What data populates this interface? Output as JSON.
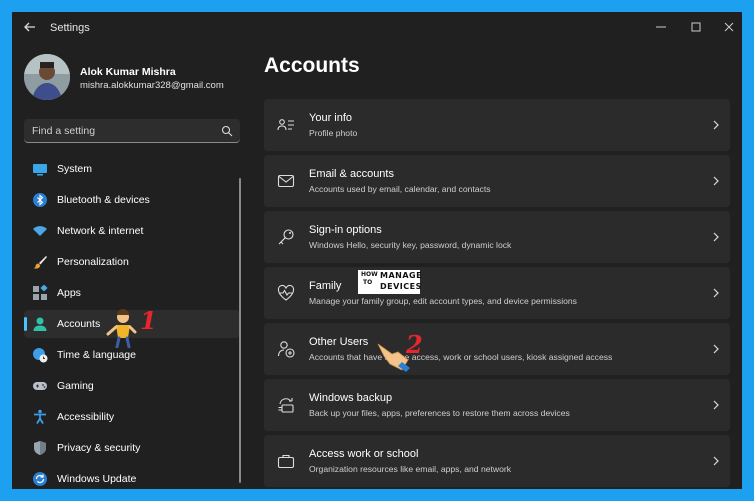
{
  "window": {
    "title": "Settings"
  },
  "profile": {
    "name": "Alok Kumar Mishra",
    "email": "mishra.alokkumar328@gmail.com"
  },
  "search": {
    "placeholder": "Find a setting"
  },
  "nav": {
    "items": [
      {
        "label": "System",
        "icon": "system-icon"
      },
      {
        "label": "Bluetooth & devices",
        "icon": "bluetooth-icon"
      },
      {
        "label": "Network & internet",
        "icon": "wifi-icon"
      },
      {
        "label": "Personalization",
        "icon": "brush-icon"
      },
      {
        "label": "Apps",
        "icon": "apps-icon"
      },
      {
        "label": "Accounts",
        "icon": "accounts-icon",
        "selected": true
      },
      {
        "label": "Time & language",
        "icon": "globe-clock-icon"
      },
      {
        "label": "Gaming",
        "icon": "gamepad-icon"
      },
      {
        "label": "Accessibility",
        "icon": "accessibility-icon"
      },
      {
        "label": "Privacy & security",
        "icon": "shield-icon"
      },
      {
        "label": "Windows Update",
        "icon": "update-icon"
      }
    ]
  },
  "main": {
    "title": "Accounts",
    "rows": [
      {
        "title": "Your info",
        "subtitle": "Profile photo",
        "icon": "person-card-icon"
      },
      {
        "title": "Email & accounts",
        "subtitle": "Accounts used by email, calendar, and contacts",
        "icon": "mail-icon"
      },
      {
        "title": "Sign-in options",
        "subtitle": "Windows Hello, security key, password, dynamic lock",
        "icon": "key-icon"
      },
      {
        "title": "Family",
        "subtitle": "Manage your family group, edit account types, and device permissions",
        "icon": "heart-icon"
      },
      {
        "title": "Other Users",
        "subtitle": "Accounts that have device access, work or school users, kiosk assigned access",
        "icon": "add-person-icon"
      },
      {
        "title": "Windows backup",
        "subtitle": "Back up your files, apps, preferences to restore them across devices",
        "icon": "backup-icon"
      },
      {
        "title": "Access work or school",
        "subtitle": "Organization resources like email, apps, and network",
        "icon": "briefcase-icon"
      }
    ]
  },
  "annotations": {
    "step1": "1",
    "step2": "2"
  },
  "watermark": {
    "line1": "HOW",
    "line2": "TO",
    "line3": "MANAGE",
    "line4": "DEVICES"
  },
  "colors": {
    "background": "#1ea0f0",
    "window": "#202020",
    "card": "#2b2b2b",
    "accent": "#4cc2ff",
    "step_number": "#e8262f"
  }
}
